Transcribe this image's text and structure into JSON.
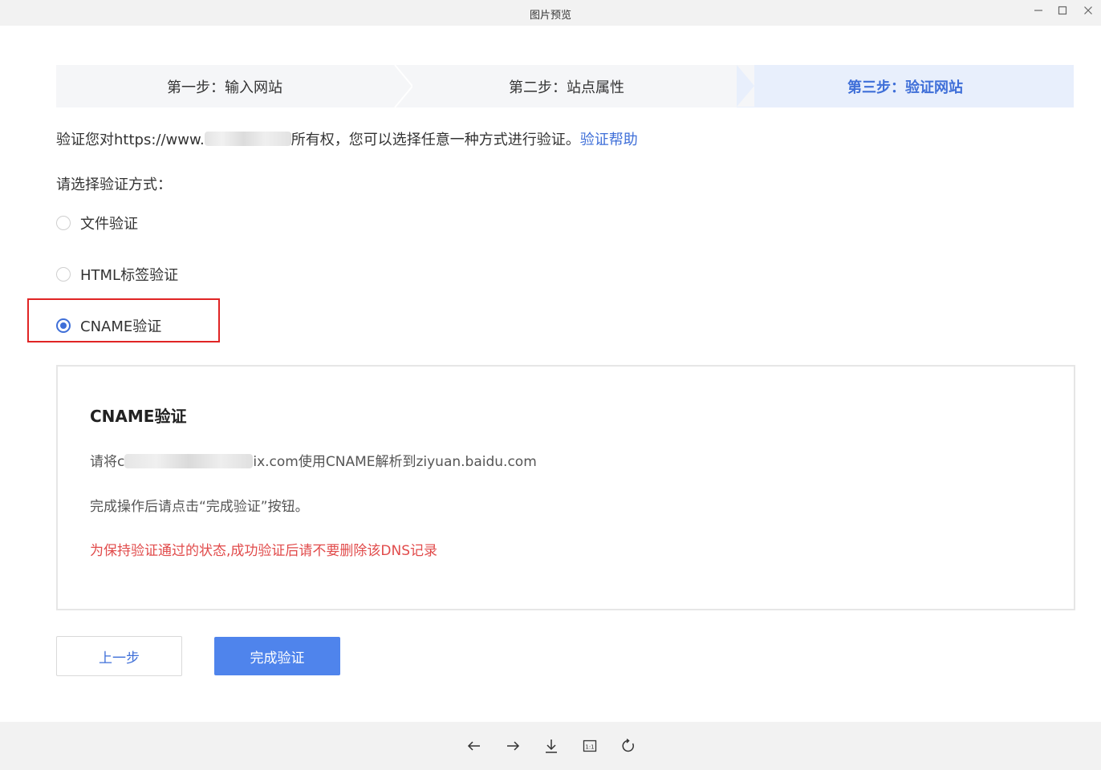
{
  "window": {
    "title": "图片预览",
    "minimize_icon": "minimize-icon",
    "maximize_icon": "maximize-icon",
    "close_icon": "close-icon"
  },
  "steps": [
    {
      "label": "第一步：输入网站",
      "active": false
    },
    {
      "label": "第二步：站点属性",
      "active": false
    },
    {
      "label": "第三步：验证网站",
      "active": true
    }
  ],
  "intro": {
    "prefix": "验证您对https://www.",
    "suffix": "所有权，您可以选择任意一种方式进行验证。",
    "help_link": "验证帮助"
  },
  "method_prompt": "请选择验证方式：",
  "methods": [
    {
      "label": "文件验证",
      "checked": false
    },
    {
      "label": "HTML标签验证",
      "checked": false
    },
    {
      "label": "CNAME验证",
      "checked": true
    }
  ],
  "panel": {
    "title": "CNAME验证",
    "line1_prefix": "请将c",
    "line1_suffix": "ix.com使用CNAME解析到ziyuan.baidu.com",
    "line2": "完成操作后请点击“完成验证”按钮。",
    "warning": "为保持验证通过的状态,成功验证后请不要删除该DNS记录"
  },
  "buttons": {
    "prev": "上一步",
    "done": "完成验证"
  },
  "colors": {
    "accent": "#3f6fd8",
    "primary_button": "#4f84ec",
    "warning": "#e14b4b",
    "highlight_border": "#e02424"
  },
  "toolbar": [
    "arrow-left-icon",
    "arrow-right-icon",
    "download-icon",
    "actual-size-icon",
    "rotate-icon"
  ]
}
